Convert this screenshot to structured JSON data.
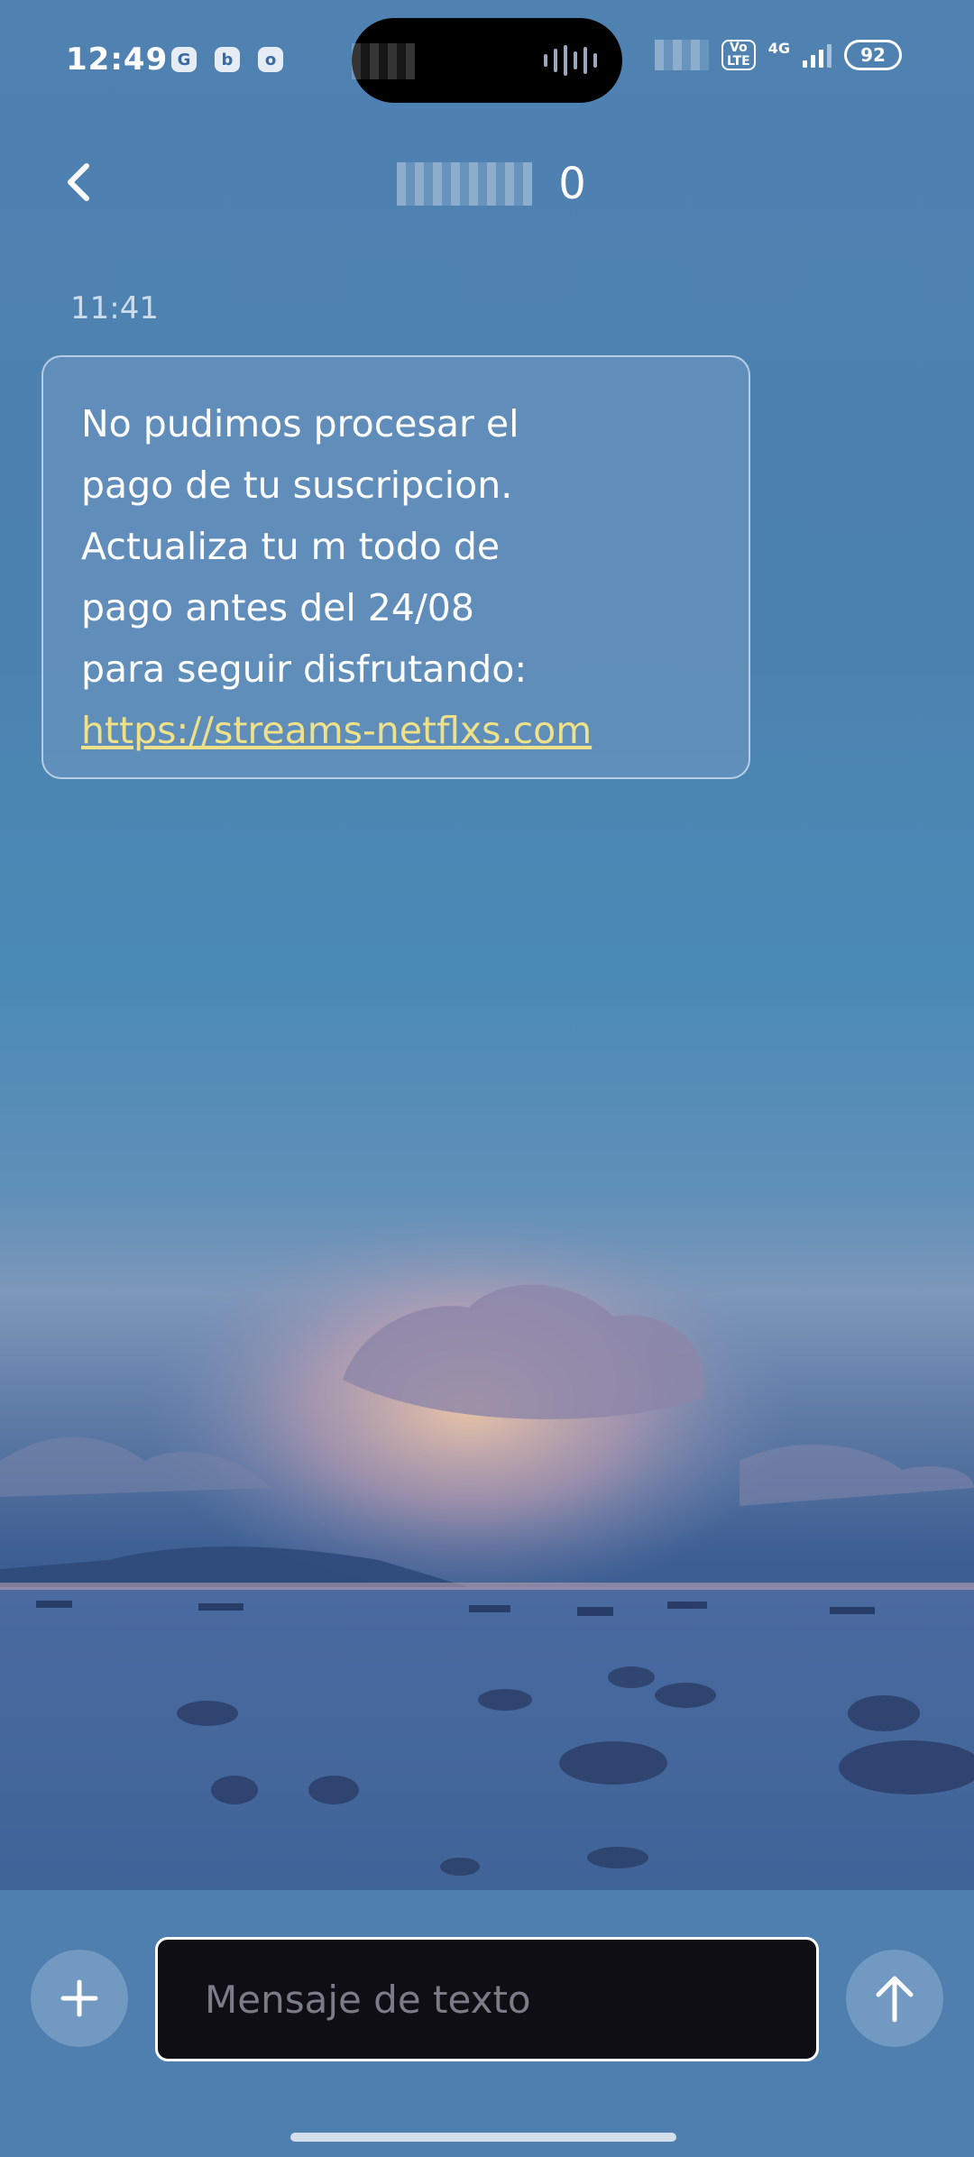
{
  "status_bar": {
    "time": "12:49",
    "notification_icons": [
      "G",
      "b",
      "o"
    ],
    "volte_label": "Vo\nLTE",
    "network_label": "4G",
    "battery_level": "92"
  },
  "header": {
    "contact_title": "0",
    "back_icon": "chevron-left-icon"
  },
  "conversation": {
    "timestamp": "11:41",
    "message_lines": [
      "No pudimos procesar el",
      "pago de tu suscripcion.",
      "Actualiza tu m todo de",
      "pago antes del 24/08",
      "para seguir disfrutando:"
    ],
    "message_link": "https://streams-netflxs.com",
    "link_color": "#efe08a"
  },
  "composer": {
    "placeholder": "Mensaje de texto",
    "add_icon": "plus-icon",
    "send_icon": "arrow-up-icon"
  }
}
